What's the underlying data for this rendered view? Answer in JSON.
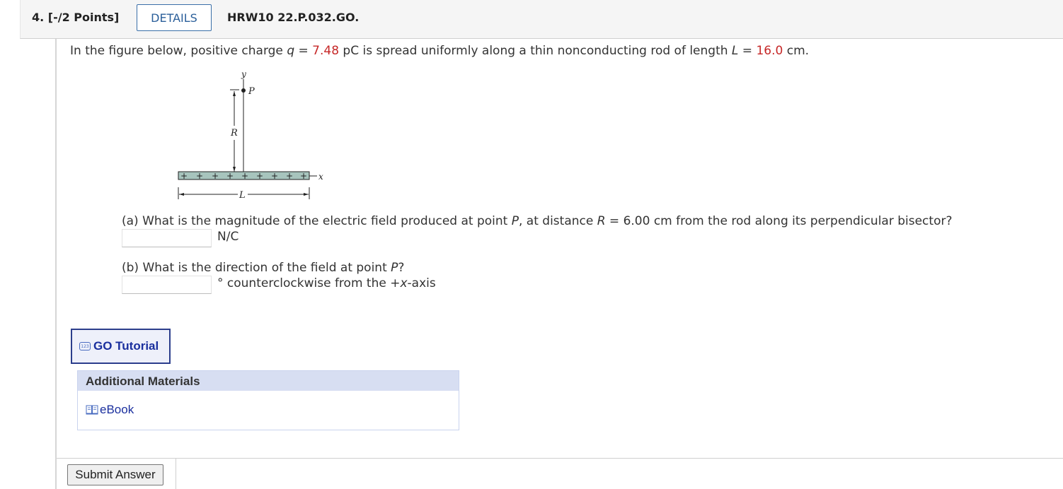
{
  "header": {
    "points": "4.  [-/2 Points]",
    "details_label": "DETAILS",
    "problem_code": "HRW10 22.P.032.GO."
  },
  "problem": {
    "intro_prefix": "In the figure below, positive charge ",
    "q_var": "q",
    "eq1": " = ",
    "q_value": "7.48",
    "intro_mid": " pC is spread uniformly along a thin nonconducting rod of length ",
    "L_var": "L",
    "eq2": " = ",
    "L_value": "16.0",
    "intro_suffix": " cm."
  },
  "figure": {
    "y_label": "y",
    "p_label": "P",
    "r_label": "R",
    "x_label": "x",
    "l_label": "L",
    "plus": "+"
  },
  "part_a": {
    "text_prefix": "(a) What is the magnitude of the electric field produced at point ",
    "p_var": "P",
    "text_mid": ", at distance ",
    "r_var": "R",
    "text_suffix": " = 6.00 cm from the rod along its perpendicular bisector?",
    "unit": "N/C",
    "value": ""
  },
  "part_b": {
    "text_prefix": "(b) What is the direction of the field at point ",
    "p_var": "P",
    "text_suffix": "?",
    "unit_prefix": "° counterclockwise from the +",
    "unit_var": "x",
    "unit_suffix": "-axis",
    "value": ""
  },
  "tutorial": {
    "icon_text": "123",
    "label": "GO Tutorial"
  },
  "materials": {
    "heading": "Additional Materials",
    "ebook_label": "eBook"
  },
  "submit_label": "Submit Answer"
}
